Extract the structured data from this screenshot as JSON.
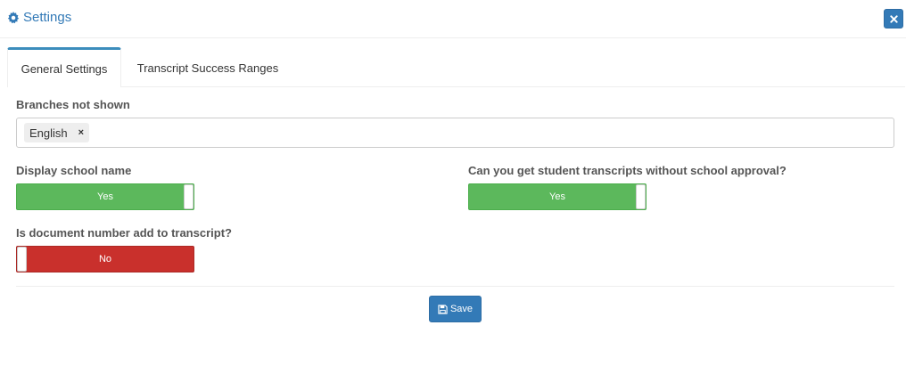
{
  "header": {
    "title": "Settings",
    "icon": "gear-icon",
    "close_icon": "close-icon",
    "accent_color": "#337ab7"
  },
  "tabs": [
    {
      "label": "General Settings",
      "active": true
    },
    {
      "label": "Transcript Success Ranges",
      "active": false
    }
  ],
  "branches": {
    "label": "Branches not shown",
    "tags": [
      {
        "text": "English",
        "remove": "×"
      }
    ]
  },
  "display_school_name": {
    "label": "Display school name",
    "state": "on",
    "text": "Yes",
    "color": "#5cb85c"
  },
  "transcripts_without_approval": {
    "label": "Can you get student transcripts without school approval?",
    "state": "on",
    "text": "Yes",
    "color": "#5cb85c"
  },
  "document_number": {
    "label": "Is document number add to transcript?",
    "state": "off",
    "text": "No",
    "color": "#c9302c"
  },
  "footer": {
    "save_label": "Save",
    "save_icon": "save-icon"
  }
}
